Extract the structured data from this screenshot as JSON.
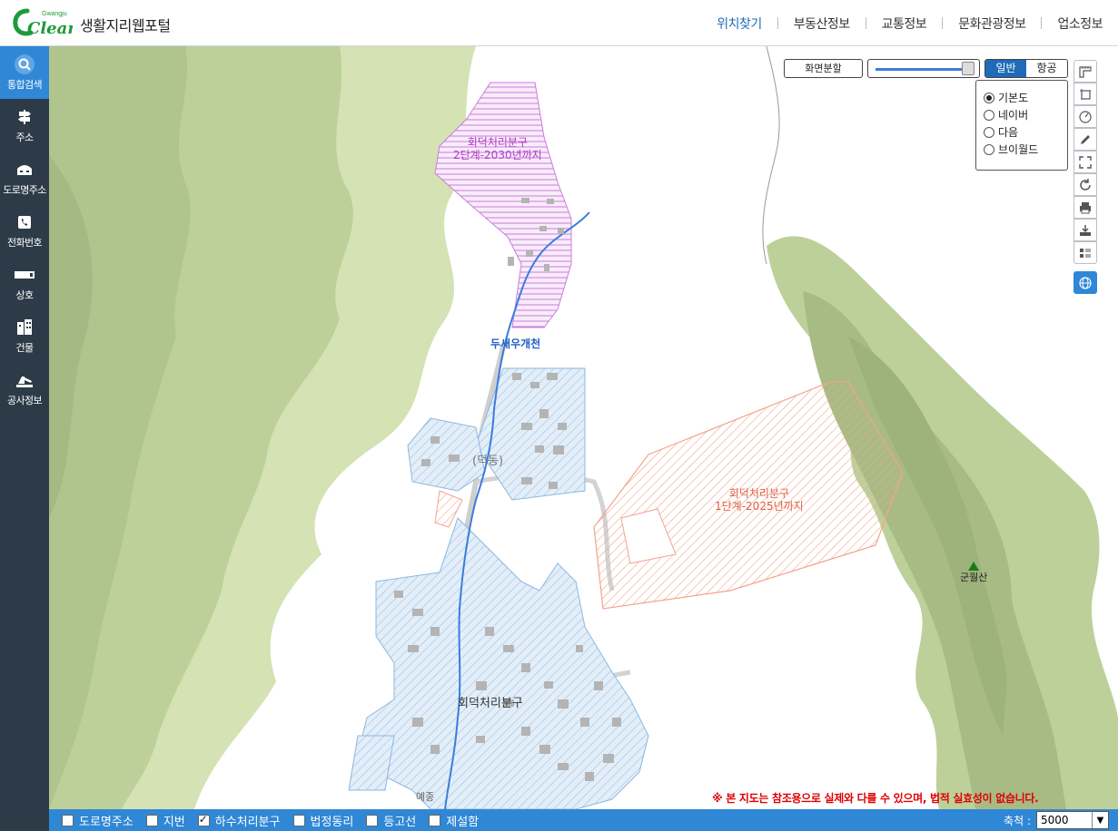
{
  "header": {
    "logo_text": "Clean",
    "logo_small": "Gwangju",
    "site_title": "생활지리웹포털",
    "nav": [
      {
        "label": "위치찾기",
        "active": true
      },
      {
        "label": "부동산정보"
      },
      {
        "label": "교통정보"
      },
      {
        "label": "문화관광정보"
      },
      {
        "label": "업소정보"
      }
    ]
  },
  "sidebar": {
    "items": [
      {
        "label": "통합검색",
        "icon": "search-icon",
        "active": true
      },
      {
        "label": "주소",
        "icon": "signpost-icon"
      },
      {
        "label": "도로명주소",
        "icon": "road-sign-icon"
      },
      {
        "label": "전화번호",
        "icon": "phone-icon"
      },
      {
        "label": "상호",
        "icon": "shop-sign-icon"
      },
      {
        "label": "건물",
        "icon": "building-icon"
      },
      {
        "label": "공사정보",
        "icon": "construction-icon"
      }
    ],
    "toggle": "›"
  },
  "map_controls": {
    "split_label": "화면분할",
    "maptype": {
      "general": "일반",
      "aerial": "항공",
      "selected": "일반"
    },
    "basemaps": [
      {
        "label": "기본도",
        "checked": true
      },
      {
        "label": "네이버",
        "checked": false
      },
      {
        "label": "다음",
        "checked": false
      },
      {
        "label": "브이월드",
        "checked": false
      }
    ],
    "tools": [
      "ruler-icon",
      "area-measure-icon",
      "radius-icon",
      "pencil-icon",
      "fullscreen-icon",
      "refresh-icon",
      "print-icon",
      "download-icon",
      "legend-icon",
      "globe-icon"
    ],
    "opacity": 1.0
  },
  "map_labels": {
    "zone2_line1": "회덕처리분구",
    "zone2_line2": "2단계-2030년까지",
    "zone1_line1": "회덕처리분구",
    "zone1_line2": "1단계-2025년까지",
    "stream": "두새우개천",
    "village": "(덕동)",
    "district": "회덕처리분구",
    "mountain": "군월산",
    "small_place": "예종"
  },
  "colors": {
    "accent": "#2f87d6",
    "sidebar_bg": "#2d3b48",
    "zone2": "#c070d0",
    "zone1": "#f0907a",
    "zone_blue": "#8ab8e0",
    "terrain_light": "#d4e2b4",
    "terrain_mid": "#bdd09a",
    "terrain_dark": "#a7ba84",
    "disclaimer": "#e00000"
  },
  "disclaimer": "※ 본 지도는 참조용으로 실제와 다를 수 있으며, 법적 실효성이 없습니다.",
  "bottom_bar": {
    "layers": [
      {
        "label": "도로명주소",
        "checked": false
      },
      {
        "label": "지번",
        "checked": false
      },
      {
        "label": "하수처리분구",
        "checked": true
      },
      {
        "label": "법정동리",
        "checked": false
      },
      {
        "label": "등고선",
        "checked": false
      },
      {
        "label": "제설함",
        "checked": false
      }
    ],
    "scale_label": "축척 :",
    "scale_value": "5000"
  }
}
